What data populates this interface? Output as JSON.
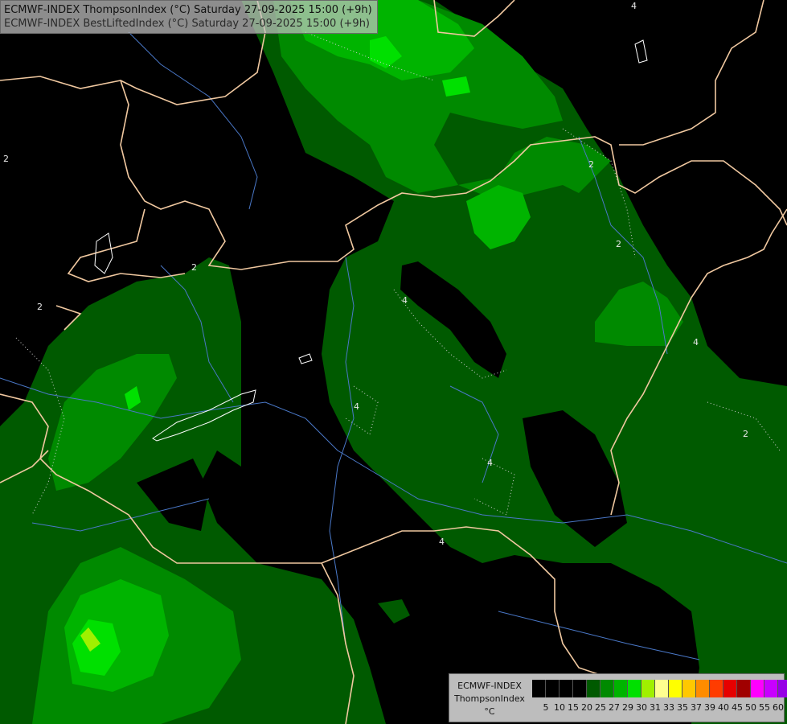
{
  "header": {
    "line1": "ECMWF-INDEX ThompsonIndex (°C) Saturday 27-09-2025 15:00 (+9h)",
    "line2": "ECMWF-INDEX BestLiftedIndex (°C) Saturday 27-09-2025 15:00 (+9h)"
  },
  "legend": {
    "model": "ECMWF-INDEX",
    "parameter": "ThompsonIndex",
    "unit": "°C",
    "colors": [
      "#000000",
      "#000000",
      "#000000",
      "#000000",
      "#005a00",
      "#008a00",
      "#00b400",
      "#00e000",
      "#a0f000",
      "#ffff90",
      "#ffff00",
      "#ffc800",
      "#ff8c00",
      "#ff3c00",
      "#e60000",
      "#a00000",
      "#ff00ff",
      "#c800ff",
      "#9600e6",
      "#6400ff",
      "#0000ff"
    ],
    "ticks": [
      "5",
      "10",
      "15",
      "20",
      "25",
      "27",
      "29",
      "30",
      "31",
      "33",
      "35",
      "37",
      "39",
      "40",
      "45",
      "50",
      "55",
      "60"
    ]
  },
  "map": {
    "colors": {
      "band1": "#005a00",
      "band2": "#008a00",
      "band3": "#00b400",
      "band4": "#00e000",
      "band5": "#a0f000",
      "border": "#f0c8a0",
      "river": "#4a78c8",
      "lake": "#ffffff"
    },
    "contour_labels": [
      "2",
      "2",
      "2",
      "2",
      "2",
      "2",
      "4",
      "4",
      "4",
      "4",
      "4",
      "4"
    ]
  }
}
